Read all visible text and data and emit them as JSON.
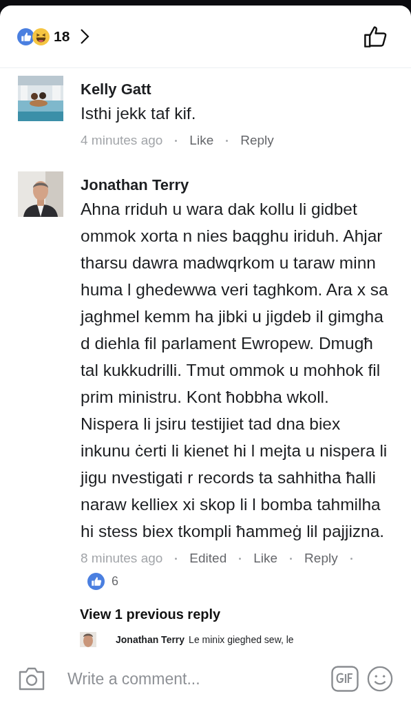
{
  "reactions": {
    "count": "18"
  },
  "comments": [
    {
      "author": "Kelly Gatt",
      "text": "Isthi jekk taf kif.",
      "time": "4 minutes ago",
      "actions": [
        "Like",
        "Reply"
      ]
    },
    {
      "author": "Jonathan Terry",
      "text": "Ahna rriduh u wara dak kollu li gidbet ommok xorta n nies baqghu iriduh. Ahjar tharsu dawra madwqrkom u taraw minn huma l ghedewwa veri taghkom. Ara x sa jaghmel kemm ha jibki u jigdeb il gimgha d diehla fil parlament Ewropew. Dmugħ tal kukkudrilli. Tmut ommok u mohhok fil prim ministru. Kont ħobbha wkoll. Nispera li jsiru testijiet tad dna biex inkunu ċerti li kienet hi l mejta u nispera li jigu nvestigati r records ta sahhitha ħalli naraw kelliex xi skop li l bomba tahmilha hi stess biex tkompli ħammeġ lil pajjizna.",
      "time": "8 minutes ago",
      "actions": [
        "Edited",
        "Like",
        "Reply"
      ],
      "likes": "6"
    }
  ],
  "previous_replies": {
    "label": "View 1 previous reply",
    "reply": {
      "author": "Jonathan Terry",
      "text": "Le minix gieghed sew, le"
    }
  },
  "composer": {
    "placeholder": "Write a comment..."
  }
}
